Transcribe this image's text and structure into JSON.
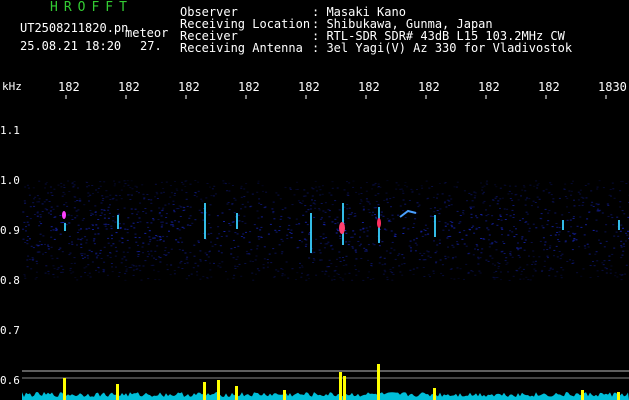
{
  "brand": {
    "name": "HROFFT",
    "color": "#33cc33"
  },
  "file": {
    "name": "UT2508211820.pn",
    "tag": "meteor"
  },
  "datetime": {
    "stamp": "25.08.21 18:20",
    "value": "27."
  },
  "info": {
    "observer_label": "Observer",
    "observer_value": ": Masaki Kano",
    "location_label": "Receiving Location",
    "location_value": ": Shibukawa, Gunma, Japan",
    "receiver_label": "Receiver",
    "receiver_value": ": RTL-SDR SDR# 43dB L15 103.2MHz CW",
    "antenna_label": "Receiving Antenna",
    "antenna_value": ": 3el Yagi(V) Az 330 for Vladivostok"
  },
  "axis": {
    "unit": "kHz",
    "time_ticks": [
      "182",
      "182",
      "182",
      "182",
      "182",
      "182",
      "182",
      "182",
      "182",
      "1830"
    ],
    "freq_ticks": [
      "1.1",
      "1.0",
      "0.9",
      "0.8",
      "0.7",
      "0.6"
    ]
  },
  "colors": {
    "background": "#000000",
    "noise": "#1a2bd6",
    "signal_line": "#00e0ff",
    "meteor": "#ffff00"
  }
}
